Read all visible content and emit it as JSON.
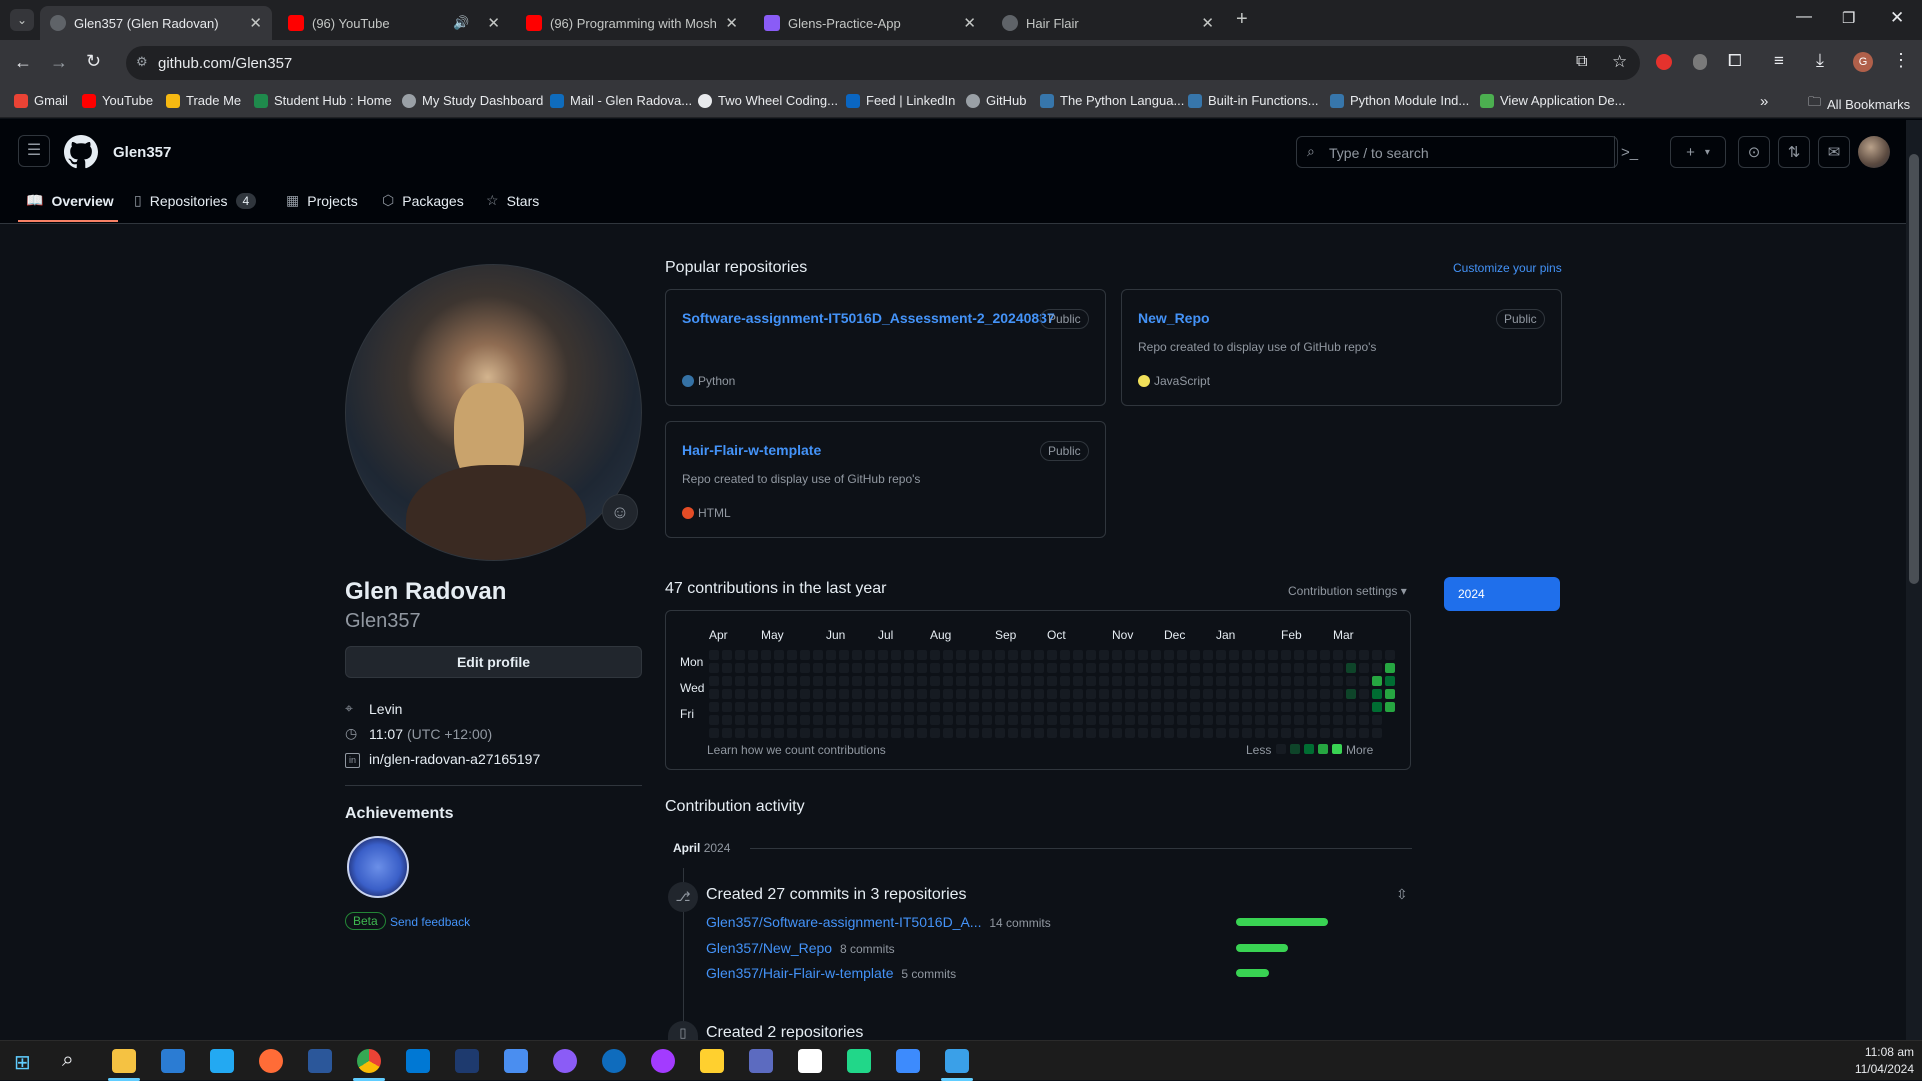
{
  "browser": {
    "tabs": [
      {
        "title": "Glen357 (Glen Radovan)",
        "active": true,
        "color": "#5f6368"
      },
      {
        "title": "(96) YouTube",
        "muted_icon": "speaker-icon",
        "color": "#ff0000"
      },
      {
        "title": "(96) Programming with Mosh -",
        "color": "#ff0000"
      },
      {
        "title": "Glens-Practice-App",
        "color": "#8a5cf6"
      },
      {
        "title": "Hair Flair",
        "color": "#5f6368"
      }
    ],
    "url": "github.com/Glen357",
    "bookmarks": [
      "Gmail",
      "YouTube",
      "Trade Me",
      "Student Hub : Home",
      "My Study Dashboard",
      "Mail - Glen Radova...",
      "Two Wheel Coding...",
      "Feed | LinkedIn",
      "GitHub",
      "The Python Langua...",
      "Built-in Functions...",
      "Python Module Ind...",
      "View Application De..."
    ],
    "all_bookmarks": "All Bookmarks",
    "more_bookmarks": "»"
  },
  "github": {
    "username": "Glen357",
    "search_placeholder": "Type / to search",
    "nav": {
      "overview": "Overview",
      "repositories": "Repositories",
      "repo_count": "4",
      "projects": "Projects",
      "packages": "Packages",
      "stars": "Stars"
    }
  },
  "profile": {
    "name": "Glen Radovan",
    "login": "Glen357",
    "edit_button": "Edit profile",
    "location": "Levin",
    "time": "11:07",
    "tz": "(UTC +12:00)",
    "linkedin": "in/glen-radovan-a27165197",
    "achievements_title": "Achievements",
    "beta": "Beta",
    "feedback": "Send feedback"
  },
  "popular": {
    "title": "Popular repositories",
    "customize": "Customize your pins",
    "repos": [
      {
        "name": "Software-assignment-IT5016D_Assessment-2_20240837",
        "visibility": "Public",
        "desc": "",
        "lang": "Python",
        "lang_color": "#3572A5"
      },
      {
        "name": "New_Repo",
        "visibility": "Public",
        "desc": "Repo created to display use of GitHub repo's",
        "lang": "JavaScript",
        "lang_color": "#f1e05a"
      },
      {
        "name": "Hair-Flair-w-template",
        "visibility": "Public",
        "desc": "Repo created to display use of GitHub repo's",
        "lang": "HTML",
        "lang_color": "#e34c26"
      }
    ]
  },
  "contributions": {
    "title": "47 contributions in the last year",
    "settings": "Contribution settings",
    "year": "2024",
    "months": [
      "Apr",
      "May",
      "Jun",
      "Jul",
      "Aug",
      "Sep",
      "Oct",
      "Nov",
      "Dec",
      "Jan",
      "Feb",
      "Mar"
    ],
    "days": [
      "Mon",
      "Wed",
      "Fri"
    ],
    "learn": "Learn how we count contributions",
    "less": "Less",
    "more": "More",
    "active_cells": [
      {
        "week": 49,
        "day": 1,
        "level": 1
      },
      {
        "week": 49,
        "day": 3,
        "level": 1
      },
      {
        "week": 51,
        "day": 2,
        "level": 3
      },
      {
        "week": 51,
        "day": 3,
        "level": 2
      },
      {
        "week": 51,
        "day": 4,
        "level": 2
      },
      {
        "week": 52,
        "day": 1,
        "level": 3
      },
      {
        "week": 52,
        "day": 2,
        "level": 2
      },
      {
        "week": 52,
        "day": 3,
        "level": 3
      },
      {
        "week": 52,
        "day": 4,
        "level": 3
      }
    ]
  },
  "activity": {
    "title": "Contribution activity",
    "month": "April",
    "year": "2024",
    "commits_title": "Created 27 commits in 3 repositories",
    "commit_rows": [
      {
        "repo": "Glen357/Software-assignment-IT5016D_A...",
        "count": "14 commits",
        "fraction": 1.0
      },
      {
        "repo": "Glen357/New_Repo",
        "count": "8 commits",
        "fraction": 0.57
      },
      {
        "repo": "Glen357/Hair-Flair-w-template",
        "count": "5 commits",
        "fraction": 0.36
      }
    ],
    "created_title": "Created 2 repositories"
  },
  "taskbar": {
    "time": "11:08 am",
    "date": "11/04/2024"
  }
}
